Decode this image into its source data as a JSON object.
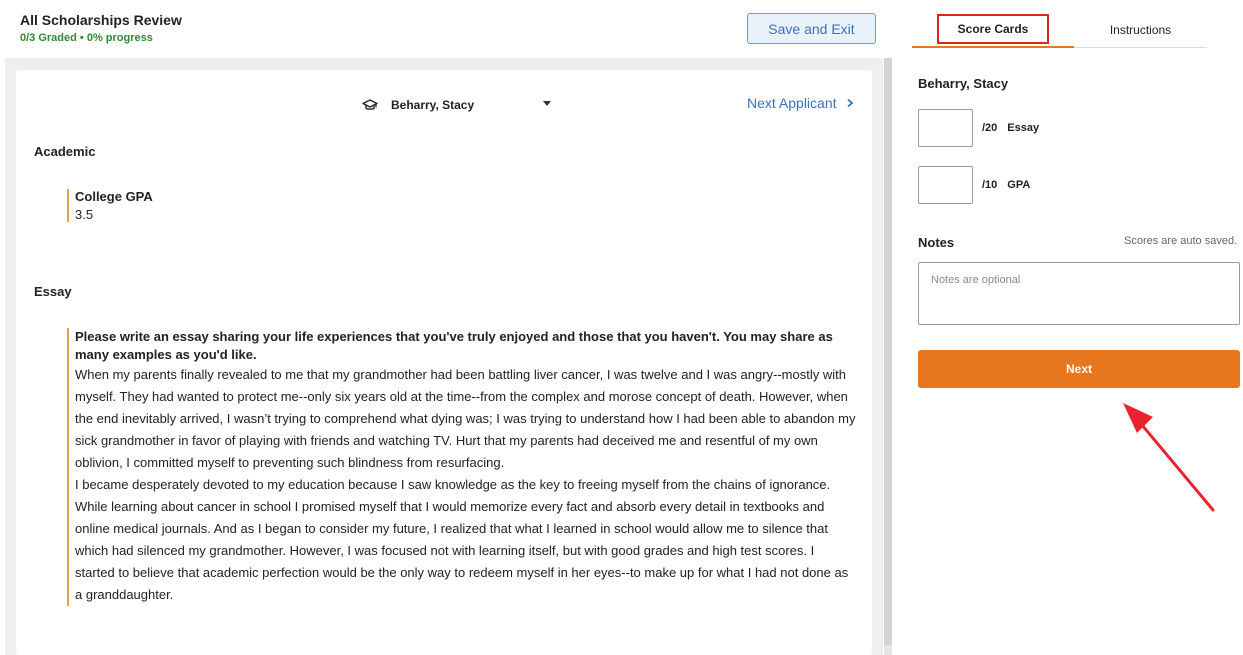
{
  "header": {
    "title": "All Scholarships Review",
    "progress": "0/3 Graded • 0% progress",
    "save_exit_label": "Save and Exit"
  },
  "applicant": {
    "name": "Beharry, Stacy",
    "icon": "graduation-cap-icon",
    "next_label": "Next Applicant"
  },
  "sections": {
    "academic": {
      "label": "Academic",
      "field_title": "College GPA",
      "field_value": "3.5"
    },
    "essay": {
      "label": "Essay",
      "question": "Please write an essay sharing your life experiences that you've truly enjoyed and those that you haven't. You may share as many examples as you'd like.",
      "paragraphs": [
        "When my parents finally revealed to me that my grandmother had been battling liver cancer, I was twelve and I was angry--mostly with myself. They had wanted to protect me--only six years old at the time--from the complex and morose concept of death. However, when the end inevitably arrived, I wasn’t trying to comprehend what dying was; I was trying to understand how I had been able to abandon my sick grandmother in favor of playing with friends and watching TV. Hurt that my parents had deceived me and resentful of my own oblivion, I committed myself to preventing such blindness from resurfacing.",
        "I became desperately devoted to my education because I saw knowledge as the key to freeing myself from the chains of ignorance. While learning about cancer in school I promised myself that I would memorize every fact and absorb every detail in textbooks and online medical journals. And as I began to consider my future, I realized that what I learned in school would allow me to silence that which had silenced my grandmother. However, I was focused not with learning itself, but with good grades and high test scores. I started to believe that academic perfection would be the only way to redeem myself in her eyes--to make up for what I had not done as a granddaughter."
      ]
    }
  },
  "scorecard": {
    "tabs": [
      {
        "label": "Score Cards",
        "active": true
      },
      {
        "label": "Instructions",
        "active": false
      }
    ],
    "applicant_name": "Beharry, Stacy",
    "scores": [
      {
        "max": "/20",
        "label": "Essay",
        "value": ""
      },
      {
        "max": "/10",
        "label": "GPA",
        "value": ""
      }
    ],
    "notes_label": "Notes",
    "auto_saved": "Scores are auto saved.",
    "notes_placeholder": "Notes are optional",
    "next_label": "Next"
  },
  "colors": {
    "accent": "#e8761d",
    "link": "#3b73b9",
    "progress_green": "#2f8a2f",
    "highlight_box": "#e0241c",
    "annotation_arrow": "#e8242a"
  }
}
